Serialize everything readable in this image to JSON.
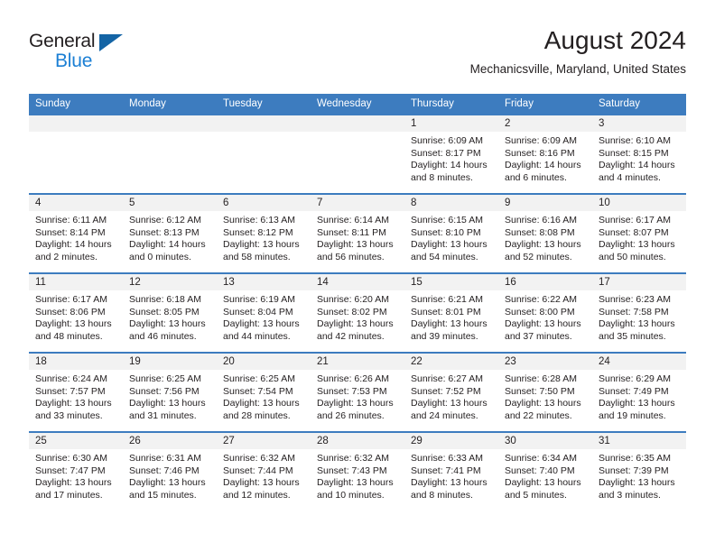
{
  "brand": {
    "name_part1": "General",
    "name_part2": "Blue",
    "triangle_color": "#1464a5",
    "blue_color": "#1b7fd4"
  },
  "header": {
    "title": "August 2024",
    "subtitle": "Mechanicsville, Maryland, United States"
  },
  "theme": {
    "header_blue": "#3d7cbf",
    "daynum_gray": "#f2f2f2",
    "text_color": "#231f20"
  },
  "weekday_headers": [
    "Sunday",
    "Monday",
    "Tuesday",
    "Wednesday",
    "Thursday",
    "Friday",
    "Saturday"
  ],
  "weeks": [
    [
      {
        "day": "",
        "sunrise": "",
        "sunset": "",
        "daylight": "",
        "empty": true
      },
      {
        "day": "",
        "sunrise": "",
        "sunset": "",
        "daylight": "",
        "empty": true
      },
      {
        "day": "",
        "sunrise": "",
        "sunset": "",
        "daylight": "",
        "empty": true
      },
      {
        "day": "",
        "sunrise": "",
        "sunset": "",
        "daylight": "",
        "empty": true
      },
      {
        "day": "1",
        "sunrise": "Sunrise: 6:09 AM",
        "sunset": "Sunset: 8:17 PM",
        "daylight": "Daylight: 14 hours and 8 minutes."
      },
      {
        "day": "2",
        "sunrise": "Sunrise: 6:09 AM",
        "sunset": "Sunset: 8:16 PM",
        "daylight": "Daylight: 14 hours and 6 minutes."
      },
      {
        "day": "3",
        "sunrise": "Sunrise: 6:10 AM",
        "sunset": "Sunset: 8:15 PM",
        "daylight": "Daylight: 14 hours and 4 minutes."
      }
    ],
    [
      {
        "day": "4",
        "sunrise": "Sunrise: 6:11 AM",
        "sunset": "Sunset: 8:14 PM",
        "daylight": "Daylight: 14 hours and 2 minutes."
      },
      {
        "day": "5",
        "sunrise": "Sunrise: 6:12 AM",
        "sunset": "Sunset: 8:13 PM",
        "daylight": "Daylight: 14 hours and 0 minutes."
      },
      {
        "day": "6",
        "sunrise": "Sunrise: 6:13 AM",
        "sunset": "Sunset: 8:12 PM",
        "daylight": "Daylight: 13 hours and 58 minutes."
      },
      {
        "day": "7",
        "sunrise": "Sunrise: 6:14 AM",
        "sunset": "Sunset: 8:11 PM",
        "daylight": "Daylight: 13 hours and 56 minutes."
      },
      {
        "day": "8",
        "sunrise": "Sunrise: 6:15 AM",
        "sunset": "Sunset: 8:10 PM",
        "daylight": "Daylight: 13 hours and 54 minutes."
      },
      {
        "day": "9",
        "sunrise": "Sunrise: 6:16 AM",
        "sunset": "Sunset: 8:08 PM",
        "daylight": "Daylight: 13 hours and 52 minutes."
      },
      {
        "day": "10",
        "sunrise": "Sunrise: 6:17 AM",
        "sunset": "Sunset: 8:07 PM",
        "daylight": "Daylight: 13 hours and 50 minutes."
      }
    ],
    [
      {
        "day": "11",
        "sunrise": "Sunrise: 6:17 AM",
        "sunset": "Sunset: 8:06 PM",
        "daylight": "Daylight: 13 hours and 48 minutes."
      },
      {
        "day": "12",
        "sunrise": "Sunrise: 6:18 AM",
        "sunset": "Sunset: 8:05 PM",
        "daylight": "Daylight: 13 hours and 46 minutes."
      },
      {
        "day": "13",
        "sunrise": "Sunrise: 6:19 AM",
        "sunset": "Sunset: 8:04 PM",
        "daylight": "Daylight: 13 hours and 44 minutes."
      },
      {
        "day": "14",
        "sunrise": "Sunrise: 6:20 AM",
        "sunset": "Sunset: 8:02 PM",
        "daylight": "Daylight: 13 hours and 42 minutes."
      },
      {
        "day": "15",
        "sunrise": "Sunrise: 6:21 AM",
        "sunset": "Sunset: 8:01 PM",
        "daylight": "Daylight: 13 hours and 39 minutes."
      },
      {
        "day": "16",
        "sunrise": "Sunrise: 6:22 AM",
        "sunset": "Sunset: 8:00 PM",
        "daylight": "Daylight: 13 hours and 37 minutes."
      },
      {
        "day": "17",
        "sunrise": "Sunrise: 6:23 AM",
        "sunset": "Sunset: 7:58 PM",
        "daylight": "Daylight: 13 hours and 35 minutes."
      }
    ],
    [
      {
        "day": "18",
        "sunrise": "Sunrise: 6:24 AM",
        "sunset": "Sunset: 7:57 PM",
        "daylight": "Daylight: 13 hours and 33 minutes."
      },
      {
        "day": "19",
        "sunrise": "Sunrise: 6:25 AM",
        "sunset": "Sunset: 7:56 PM",
        "daylight": "Daylight: 13 hours and 31 minutes."
      },
      {
        "day": "20",
        "sunrise": "Sunrise: 6:25 AM",
        "sunset": "Sunset: 7:54 PM",
        "daylight": "Daylight: 13 hours and 28 minutes."
      },
      {
        "day": "21",
        "sunrise": "Sunrise: 6:26 AM",
        "sunset": "Sunset: 7:53 PM",
        "daylight": "Daylight: 13 hours and 26 minutes."
      },
      {
        "day": "22",
        "sunrise": "Sunrise: 6:27 AM",
        "sunset": "Sunset: 7:52 PM",
        "daylight": "Daylight: 13 hours and 24 minutes."
      },
      {
        "day": "23",
        "sunrise": "Sunrise: 6:28 AM",
        "sunset": "Sunset: 7:50 PM",
        "daylight": "Daylight: 13 hours and 22 minutes."
      },
      {
        "day": "24",
        "sunrise": "Sunrise: 6:29 AM",
        "sunset": "Sunset: 7:49 PM",
        "daylight": "Daylight: 13 hours and 19 minutes."
      }
    ],
    [
      {
        "day": "25",
        "sunrise": "Sunrise: 6:30 AM",
        "sunset": "Sunset: 7:47 PM",
        "daylight": "Daylight: 13 hours and 17 minutes."
      },
      {
        "day": "26",
        "sunrise": "Sunrise: 6:31 AM",
        "sunset": "Sunset: 7:46 PM",
        "daylight": "Daylight: 13 hours and 15 minutes."
      },
      {
        "day": "27",
        "sunrise": "Sunrise: 6:32 AM",
        "sunset": "Sunset: 7:44 PM",
        "daylight": "Daylight: 13 hours and 12 minutes."
      },
      {
        "day": "28",
        "sunrise": "Sunrise: 6:32 AM",
        "sunset": "Sunset: 7:43 PM",
        "daylight": "Daylight: 13 hours and 10 minutes."
      },
      {
        "day": "29",
        "sunrise": "Sunrise: 6:33 AM",
        "sunset": "Sunset: 7:41 PM",
        "daylight": "Daylight: 13 hours and 8 minutes."
      },
      {
        "day": "30",
        "sunrise": "Sunrise: 6:34 AM",
        "sunset": "Sunset: 7:40 PM",
        "daylight": "Daylight: 13 hours and 5 minutes."
      },
      {
        "day": "31",
        "sunrise": "Sunrise: 6:35 AM",
        "sunset": "Sunset: 7:39 PM",
        "daylight": "Daylight: 13 hours and 3 minutes."
      }
    ]
  ]
}
